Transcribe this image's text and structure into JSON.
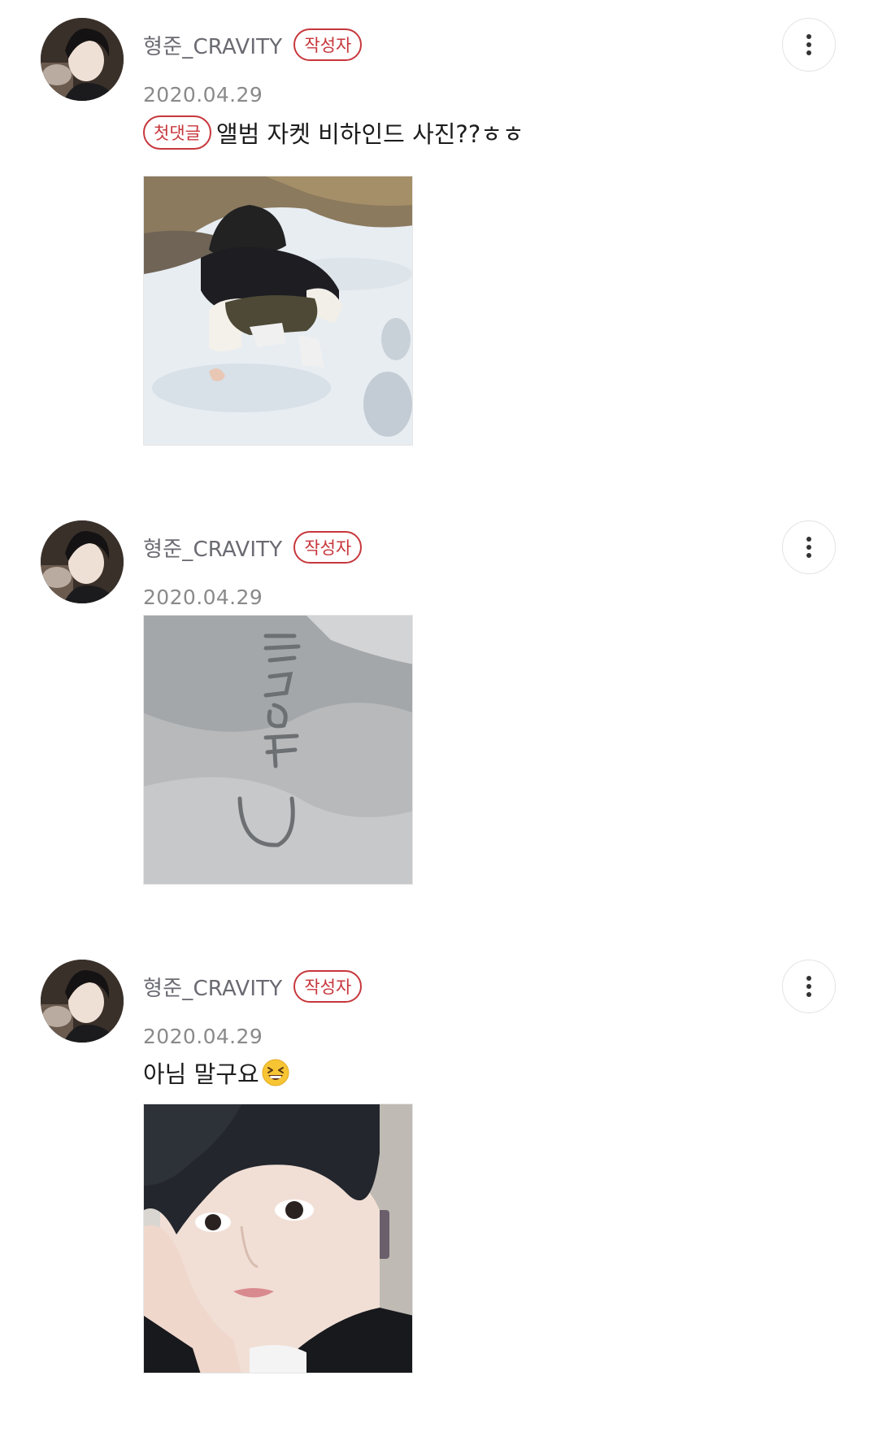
{
  "comments": [
    {
      "author": "형준_CRAVITY",
      "author_badge": "작성자",
      "date": "2020.04.29",
      "first_badge": "첫댓글",
      "text": "앨범 자켓 비하인드 사진??ㅎㅎ",
      "image": "photo-boy-crouching-in-snow"
    },
    {
      "author": "형준_CRAVITY",
      "author_badge": "작성자",
      "date": "2020.04.29",
      "image": "photo-writing-in-snow"
    },
    {
      "author": "형준_CRAVITY",
      "author_badge": "작성자",
      "date": "2020.04.29",
      "text": "아님 말구요",
      "emoji": "grinning-squinting-face-emoji",
      "image": "photo-selfie-hand-on-cheek"
    }
  ],
  "icons": {
    "more": "vertical-ellipsis-icon"
  },
  "colors": {
    "badge_red": "#c7373c",
    "author_gray": "#6a6a72",
    "date_gray": "#8a8a8a"
  }
}
